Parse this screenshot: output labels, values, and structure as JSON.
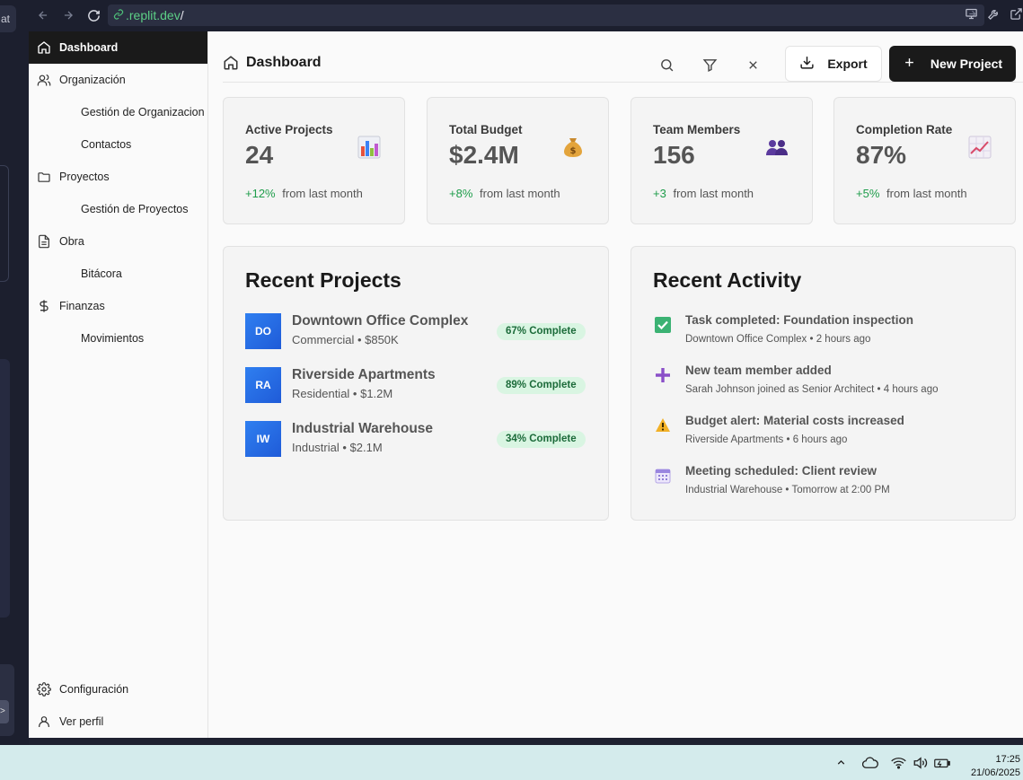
{
  "browser": {
    "url_domain": ".replit.dev",
    "url_path": "/",
    "outer_tab_fragment": "at"
  },
  "sidebar": {
    "items": [
      {
        "label": "Dashboard",
        "icon": "home-icon"
      },
      {
        "label": "Organización",
        "icon": "users-icon"
      },
      {
        "label": "Gestión de Organizacion"
      },
      {
        "label": "Contactos"
      },
      {
        "label": "Proyectos",
        "icon": "folder-icon"
      },
      {
        "label": "Gestión de Proyectos"
      },
      {
        "label": "Obra",
        "icon": "document-icon"
      },
      {
        "label": "Bitácora"
      },
      {
        "label": "Finanzas",
        "icon": "dollar-icon"
      },
      {
        "label": "Movimientos"
      }
    ],
    "footer": [
      {
        "label": "Configuración",
        "icon": "gear-icon"
      },
      {
        "label": "Ver perfil",
        "icon": "user-icon"
      }
    ]
  },
  "header": {
    "title": "Dashboard",
    "export_label": "Export",
    "new_project_label": "New Project"
  },
  "stats": [
    {
      "label": "Active Projects",
      "value": "24",
      "change": "+12%",
      "change_text": "from last month",
      "icon": "bar-chart-emoji-icon"
    },
    {
      "label": "Total Budget",
      "value": "$2.4M",
      "change": "+8%",
      "change_text": "from last month",
      "icon": "money-bag-emoji-icon"
    },
    {
      "label": "Team Members",
      "value": "156",
      "change": "+3",
      "change_text": "from last month",
      "icon": "people-emoji-icon"
    },
    {
      "label": "Completion Rate",
      "value": "87%",
      "change": "+5%",
      "change_text": "from last month",
      "icon": "trending-up-emoji-icon"
    }
  ],
  "recent_projects": {
    "title": "Recent Projects",
    "items": [
      {
        "initials": "DO",
        "name": "Downtown Office Complex",
        "meta": "Commercial • $850K",
        "progress": "67% Complete"
      },
      {
        "initials": "RA",
        "name": "Riverside Apartments",
        "meta": "Residential • $1.2M",
        "progress": "89% Complete"
      },
      {
        "initials": "IW",
        "name": "Industrial Warehouse",
        "meta": "Industrial • $2.1M",
        "progress": "34% Complete"
      }
    ]
  },
  "recent_activity": {
    "title": "Recent Activity",
    "items": [
      {
        "icon": "check-box-emoji-icon",
        "title": "Task completed: Foundation inspection",
        "meta": "Downtown Office Complex • 2 hours ago"
      },
      {
        "icon": "plus-emoji-icon",
        "title": "New team member added",
        "meta": "Sarah Johnson joined as Senior Architect • 4 hours ago"
      },
      {
        "icon": "warning-emoji-icon",
        "title": "Budget alert: Material costs increased",
        "meta": "Riverside Apartments • 6 hours ago"
      },
      {
        "icon": "calendar-emoji-icon",
        "title": "Meeting scheduled: Client review",
        "meta": "Industrial Warehouse • Tomorrow at 2:00 PM"
      }
    ]
  },
  "taskbar": {
    "time": "17:25",
    "date": "21/06/2025"
  },
  "colors": {
    "accent_dark": "#1a1a1a",
    "positive": "#1f9d4b",
    "badge_bg": "#d9f5e2",
    "avatar_blue": "#2f7ff0"
  }
}
